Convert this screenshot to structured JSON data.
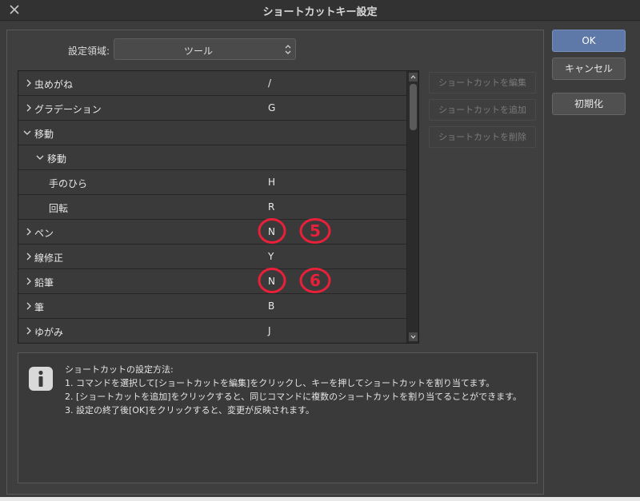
{
  "window": {
    "title": "ショートカットキー設定"
  },
  "settings_area": {
    "label": "設定領域:",
    "selected": "ツール"
  },
  "tree": {
    "rows": [
      {
        "name": "虫めがね",
        "key": "/",
        "level": 0,
        "expanded": false
      },
      {
        "name": "グラデーション",
        "key": "G",
        "level": 0,
        "expanded": false
      },
      {
        "name": "移動",
        "key": "",
        "level": 0,
        "expanded": true
      },
      {
        "name": "移動",
        "key": "",
        "level": 1,
        "expanded": true
      },
      {
        "name": "手のひら",
        "key": "H",
        "level": 2,
        "expanded": null
      },
      {
        "name": "回転",
        "key": "R",
        "level": 2,
        "expanded": null
      },
      {
        "name": "ペン",
        "key": "N",
        "level": 0,
        "expanded": false
      },
      {
        "name": "線修正",
        "key": "Y",
        "level": 0,
        "expanded": false
      },
      {
        "name": "鉛筆",
        "key": "N",
        "level": 0,
        "expanded": false
      },
      {
        "name": "筆",
        "key": "B",
        "level": 0,
        "expanded": false
      },
      {
        "name": "ゆがみ",
        "key": "J",
        "level": 0,
        "expanded": false
      }
    ]
  },
  "side_buttons": {
    "edit": "ショートカットを編集",
    "add": "ショートカットを追加",
    "delete": "ショートカットを削除"
  },
  "dialog_buttons": {
    "ok": "OK",
    "cancel": "キャンセル",
    "reset": "初期化"
  },
  "info": {
    "lines": [
      "ショートカットの設定方法:",
      "1. コマンドを選択して[ショートカットを編集]をクリックし、キーを押してショートカットを割り当てます。",
      "2. [ショートカットを追加]をクリックすると、同じコマンドに複数のショートカットを割り当てることができます。",
      "3. 設定の終了後[OK]をクリックすると、変更が反映されます。"
    ]
  },
  "annotations": {
    "mark_5": "5",
    "mark_6": "6",
    "color": "#e8203a"
  }
}
